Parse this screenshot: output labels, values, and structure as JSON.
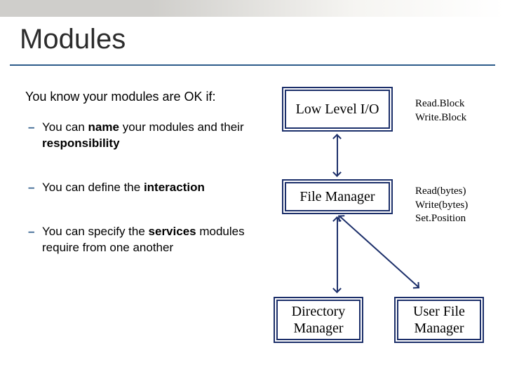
{
  "title": "Modules",
  "intro": "You know your modules are OK if:",
  "bullets": [
    {
      "pre": "You can ",
      "b1": "name",
      "mid": " your modules and their ",
      "b2": "responsibility",
      "post": ""
    },
    {
      "pre": "You can define the ",
      "b1": "interaction",
      "mid": "",
      "b2": "",
      "post": ""
    },
    {
      "pre": "You can specify the ",
      "b1": "services",
      "mid": " modules require from one another",
      "b2": "",
      "post": ""
    }
  ],
  "boxes": {
    "lowlevel": "Low Level I/O",
    "filemgr": "File Manager",
    "dirmgr": "Directory Manager",
    "usermgr": "User File Manager"
  },
  "labels": {
    "lowlevel": "Read.Block\nWrite.Block",
    "filemgr": "Read(bytes)\nWrite(bytes)\nSet.Position"
  }
}
